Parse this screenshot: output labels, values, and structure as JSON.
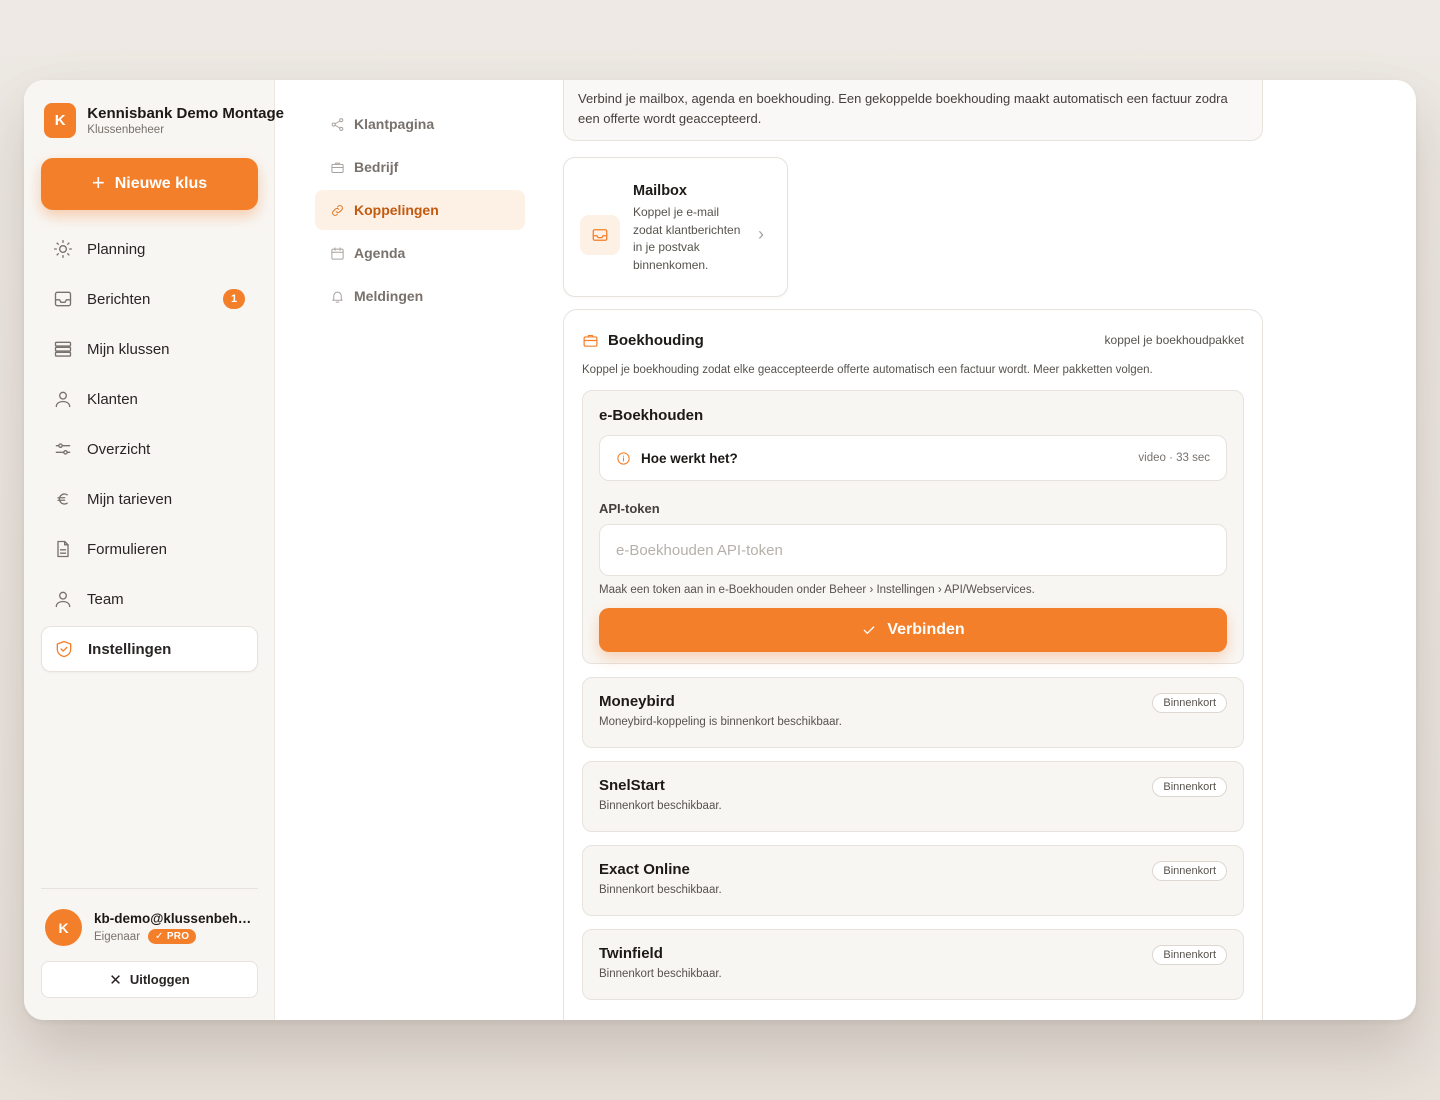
{
  "brand": {
    "initial": "K",
    "name": "Kennisbank Demo Montage",
    "subtitle": "Klussenbeheer"
  },
  "new_job_label": "Nieuwe klus",
  "nav": [
    {
      "label": "Planning",
      "icon": "sun-icon"
    },
    {
      "label": "Berichten",
      "icon": "inbox-icon",
      "badge": "1"
    },
    {
      "label": "Mijn klussen",
      "icon": "layers-icon"
    },
    {
      "label": "Klanten",
      "icon": "user-icon"
    },
    {
      "label": "Overzicht",
      "icon": "sliders-icon"
    },
    {
      "label": "Mijn tarieven",
      "icon": "euro-icon"
    },
    {
      "label": "Formulieren",
      "icon": "document-icon"
    },
    {
      "label": "Team",
      "icon": "user-icon"
    },
    {
      "label": "Instellingen",
      "icon": "shield-icon",
      "active": true
    }
  ],
  "user": {
    "initial": "K",
    "email": "kb-demo@klussenbeheer.nl",
    "role": "Eigenaar",
    "plan": "PRO"
  },
  "logout_label": "Uitloggen",
  "subnav": [
    {
      "label": "Klantpagina",
      "icon": "share-icon"
    },
    {
      "label": "Bedrijf",
      "icon": "briefcase-icon"
    },
    {
      "label": "Koppelingen",
      "icon": "link-icon",
      "active": true
    },
    {
      "label": "Agenda",
      "icon": "calendar-icon"
    },
    {
      "label": "Meldingen",
      "icon": "bell-icon"
    }
  ],
  "intro": "Verbind je mailbox, agenda en boekhouding. Een gekoppelde boekhouding maakt automatisch een factuur zodra een offerte wordt geaccepteerd.",
  "mailbox": {
    "title": "Mailbox",
    "description": "Koppel je e-mail zodat klantberichten in je postvak binnenkomen."
  },
  "accounting": {
    "title": "Boekhouding",
    "hint": "koppel je boekhoudpakket",
    "description": "Koppel je boekhouding zodat elke geaccepteerde offerte automatisch een factuur wordt. Meer pakketten volgen.",
    "eboekhouden": {
      "name": "e-Boekhouden",
      "howto_label": "Hoe werkt het?",
      "howto_meta": "video · 33 sec",
      "token_label": "API-token",
      "token_placeholder": "e-Boekhouden API-token",
      "token_value": "",
      "token_help": "Maak een token aan in e-Boekhouden onder Beheer › Instellingen › API/Webservices.",
      "connect_label": "Verbinden"
    },
    "coming_soon": [
      {
        "name": "Moneybird",
        "description": "Moneybird-koppeling is binnenkort beschikbaar.",
        "badge": "Binnenkort"
      },
      {
        "name": "SnelStart",
        "description": "Binnenkort beschikbaar.",
        "badge": "Binnenkort"
      },
      {
        "name": "Exact Online",
        "description": "Binnenkort beschikbaar.",
        "badge": "Binnenkort"
      },
      {
        "name": "Twinfield",
        "description": "Binnenkort beschikbaar.",
        "badge": "Binnenkort"
      }
    ]
  },
  "colors": {
    "accent": "#f47f2a",
    "accent_soft": "#fdf0e4",
    "surface": "#f8f6f3"
  }
}
